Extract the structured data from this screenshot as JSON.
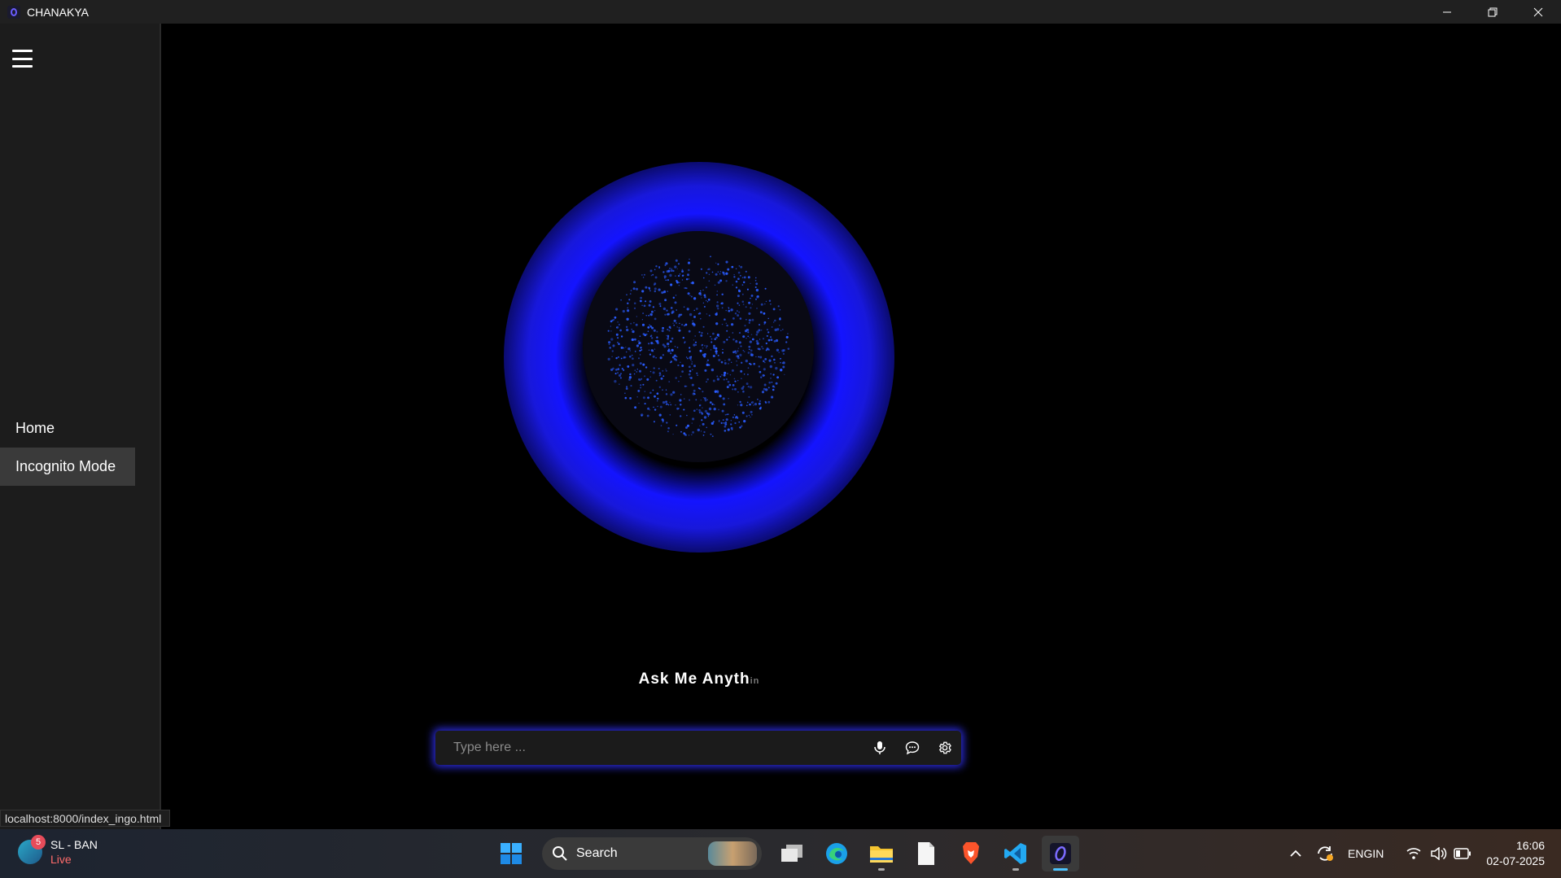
{
  "window": {
    "title": "CHANAKYA",
    "minimize_symbol": "—",
    "maximize_symbol": "❐",
    "close_symbol": "✕"
  },
  "sidebar": {
    "menu_icon": "hamburger-icon",
    "items": [
      {
        "label": "Home",
        "active": false
      },
      {
        "label": "Incognito Mode",
        "active": true
      }
    ]
  },
  "main": {
    "orb_colors": {
      "glow": "#1414ff",
      "particles": "#2a5cff"
    },
    "prompt_visible": "Ask Me Anyth",
    "prompt_faded": "in",
    "input": {
      "placeholder": "Type here ...",
      "value": ""
    },
    "icons": [
      "microphone-icon",
      "chat-bubble-icon",
      "settings-gear-icon"
    ]
  },
  "status_bar": {
    "url": "localhost:8000/index_ingo.html"
  },
  "taskbar": {
    "news": {
      "badge": "5",
      "title": "SL - BAN",
      "subtitle": "Live"
    },
    "search_label": "Search",
    "apps": [
      "windows-start-icon",
      "task-view-icon",
      "edge-icon",
      "file-explorer-icon",
      "notepad-icon",
      "brave-icon",
      "vscode-icon",
      "chanakya-app-icon"
    ],
    "tray": {
      "lang_line1": "ENG",
      "lang_line2": "IN",
      "time": "16:06",
      "date": "02-07-2025"
    }
  }
}
